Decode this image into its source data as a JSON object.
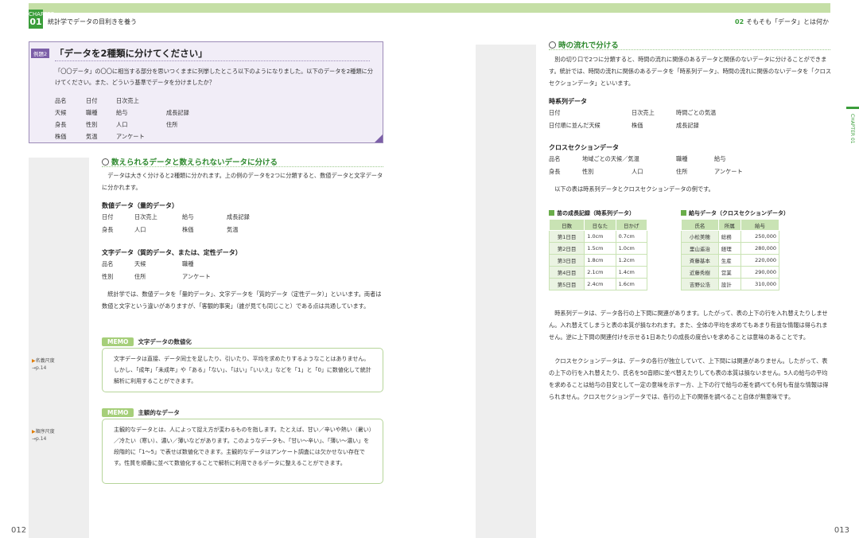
{
  "left": {
    "chapter_label": "CHAPTER",
    "chapter_num": "01",
    "header_title": "統計学でデータの目利きを養う",
    "folio": "012",
    "example": {
      "tag": "例題2",
      "title": "「データを2種類に分けてください」",
      "text": "「〇〇データ」の〇〇に相当する部分を思いつくままに列挙したところ以下のようになりました。以下のデータを2種類に分けてください。また、どういう基準でデータを分けましたか？",
      "rows": [
        [
          "品名",
          "日付",
          "日次売上",
          ""
        ],
        [
          "天候",
          "職種",
          "給与",
          "成長記録"
        ],
        [
          "身長",
          "性別",
          "人口",
          "住所"
        ],
        [
          "株価",
          "気温",
          "アンケート",
          ""
        ]
      ]
    },
    "section": {
      "title": "数えられるデータと数えられないデータに分ける",
      "intro": "データは大きく分けると2種類に分かれます。上の例のデータを2つに分類すると、数値データと文字データに分かれます。",
      "numeric_head": "数値データ（量的データ）",
      "numeric_rows": [
        [
          "日付",
          "日次売上",
          "給与",
          "成長記録"
        ],
        [
          "身長",
          "人口",
          "株価",
          "気温"
        ]
      ],
      "text_head": "文字データ（質的データ、または、定性データ）",
      "text_rows": [
        [
          "品名",
          "天候",
          "職種"
        ],
        [
          "性別",
          "住所",
          "アンケート"
        ]
      ],
      "para2": "統計学では、数値データを「量的データ」、文字データを「質的データ（定性データ）」といいます。両者は数値と文字という違いがありますが、「客観的事実」（誰が見ても同じこと）である点は共通しています。"
    },
    "memo1": {
      "tag": "MEMO",
      "title": "文字データの数値化",
      "text": "文字データは直接、データ同士を足したり、引いたり、平均を求めたりするようなことはありません。しかし、「成年」「未成年」や「ある」「ない」、「はい」「いいえ」などを「1」と「0」に数値化して統計解析に利用することができます。"
    },
    "memo2": {
      "tag": "MEMO",
      "title": "主観的なデータ",
      "text": "主観的なデータとは、人によって捉え方が変わるものを指します。たとえば、甘い／辛いや熱い（暑い）／冷たい（寒い）、濃い／薄いなどがあります。このようなデータも、「甘い〜辛い」、「薄い〜濃い」を段階的に「1〜5」で表せば数値化できます。主観的なデータはアンケート調査には欠かせない存在です。性質を順番に並べて数値化することで解析に利用できるデータに整えることができます。"
    },
    "side_notes": [
      {
        "label": "名義尺度",
        "ref": "→p.14"
      },
      {
        "label": "順序尺度",
        "ref": "→p.14"
      }
    ]
  },
  "right": {
    "header_num": "02",
    "header_title": "そもそも「データ」とは何か",
    "folio": "013",
    "chapter_tab": "CHAPTER 01",
    "section": {
      "title": "時の流れで分ける",
      "intro": "別の切り口で2つに分類すると、時間の流れに関係のあるデータと関係のないデータに分けることができます。統計では、時間の流れに関係のあるデータを「時系列データ」、時間の流れに関係のないデータを「クロスセクションデータ」といいます。",
      "ts_head": "時系列データ",
      "ts_rows": [
        [
          "日付",
          "日次売上",
          "時間ごとの気温"
        ],
        [
          "日付順に並んだ天候",
          "株価",
          "成長記録"
        ]
      ],
      "cs_head": "クロスセクションデータ",
      "cs_rows": [
        [
          "品名",
          "地域ごとの天候／気温",
          "",
          "職種",
          "給与"
        ],
        [
          "身長",
          "性別",
          "人口",
          "住所",
          "アンケート"
        ]
      ],
      "example_line": "以下の表は時系列データとクロスセクションデータの例です。"
    },
    "table1": {
      "title": "苗の成長記録（時系列データ）",
      "headers": [
        "日数",
        "日なた",
        "日かげ"
      ],
      "rows": [
        [
          "第1日目",
          "1.0cm",
          "0.7cm"
        ],
        [
          "第2日目",
          "1.5cm",
          "1.0cm"
        ],
        [
          "第3日目",
          "1.8cm",
          "1.2cm"
        ],
        [
          "第4日目",
          "2.1cm",
          "1.4cm"
        ],
        [
          "第5日目",
          "2.4cm",
          "1.6cm"
        ]
      ]
    },
    "table2": {
      "title": "給与データ（クロスセクションデータ）",
      "headers": [
        "氏名",
        "所属",
        "給与"
      ],
      "rows": [
        [
          "小松美穂",
          "総務",
          "250,000"
        ],
        [
          "里山遥治",
          "経理",
          "280,000"
        ],
        [
          "斉藤基本",
          "生産",
          "220,000"
        ],
        [
          "近藤秀樹",
          "営業",
          "290,000"
        ],
        [
          "吉野公浩",
          "設計",
          "310,000"
        ]
      ]
    },
    "para_ts": "時系列データは、データ各行の上下間に関連があります。したがって、表の上下の行を入れ替えたりしません。入れ替えてしまうと表の本質が損なわれます。また、全体の平均を求めてもあまり有益な情報は得られません。逆に上下間の関連付けを示せる1日あたりの成長の度合いを求めることは意味のあることです。",
    "para_cs": "クロスセクションデータは、データの各行が独立していて、上下間には関連がありません。したがって、表の上下の行を入れ替えたり、氏名を50音順に並べ替えたりしても表の本質は損ないません。5人の給与の平均を求めることは給与の目安として一定の意味を示す一方、上下の行で給与の差を調べても何も有益な情報は得られません。クロスセクションデータでは、各行の上下の関係を調べること自体が無意味です。"
  },
  "colors": {
    "accent_green": "#3a9d3a",
    "example_purple": "#7c5fa8",
    "memo_green": "#a6cf7a"
  }
}
